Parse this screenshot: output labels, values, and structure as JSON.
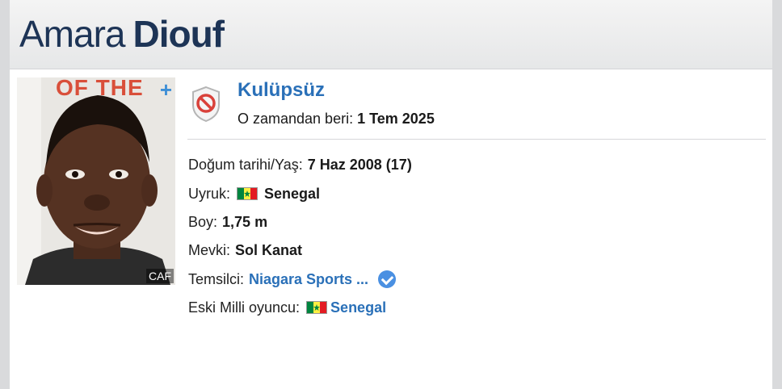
{
  "player": {
    "first_name": "Amara",
    "last_name": "Diouf",
    "photo_credit": "CAF",
    "photo_bg_text": "OF THE",
    "photo_plus": "+"
  },
  "club": {
    "name": "Kulüpsüz",
    "since_label": "O zamandan beri:",
    "since_value": "1 Tem 2025",
    "badge_icon": "no-club-shield-icon"
  },
  "details": {
    "birth_label": "Doğum tarihi/Yaş:",
    "birth_value": "7 Haz 2008 (17)",
    "nationality_label": "Uyruk:",
    "nationality_value": "Senegal",
    "height_label": "Boy:",
    "height_value": "1,75 m",
    "position_label": "Mevki:",
    "position_value": "Sol Kanat",
    "agent_label": "Temsilci:",
    "agent_value": "Niagara Sports ...",
    "former_national_label": "Eski Milli oyuncu:",
    "former_national_value": "Senegal"
  },
  "colors": {
    "accent": "#2a70b8",
    "title": "#1d3456",
    "flag_green": "#00853f",
    "flag_yellow": "#fdef42",
    "flag_red": "#e31b23"
  }
}
